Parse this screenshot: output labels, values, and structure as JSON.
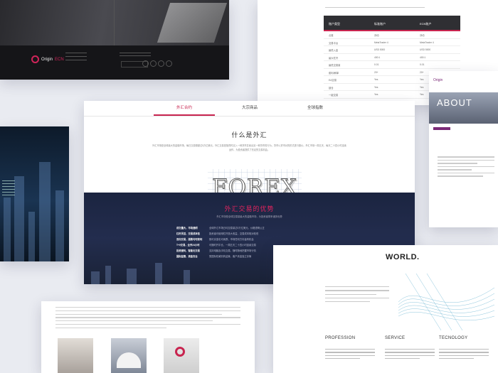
{
  "top_left_card": {
    "brand_name": "Origin",
    "brand_suffix": "ECN"
  },
  "account_table": {
    "headers": [
      "账户类型",
      "标准账户",
      "ECN账户"
    ],
    "rows": [
      [
        "点差",
        "浮动",
        "浮动"
      ],
      [
        "交易平台",
        "MetaTrader 4",
        "MetaTrader 4"
      ],
      [
        "最低入金",
        "USD 5000",
        "USD 5000"
      ],
      [
        "最大杠杆",
        "400:1",
        "400:1"
      ],
      [
        "最低交易量",
        "0.01",
        "0.01"
      ],
      [
        "套利/刷单",
        "20+",
        "20+"
      ],
      [
        "EA交易",
        "Yes",
        "Yes"
      ],
      [
        "锁仓",
        "Yes",
        "Yes"
      ],
      [
        "一键交易",
        "Yes",
        "Yes"
      ]
    ]
  },
  "about_card": {
    "brand": "Origin",
    "heading": "ABOUT"
  },
  "main": {
    "tabs": [
      {
        "label": "外汇合约",
        "active": true
      },
      {
        "label": "大宗商品",
        "active": false
      },
      {
        "label": "全球指数",
        "active": false
      }
    ],
    "title": "什么是外汇",
    "intro": "外汇市场是全球最大的金融市场，每日交易额超过5万亿美元。外汇交易是指同时买入一种货币并卖出另一种货币的行为，货币以货币对的形式进行报价。外汇市场一周五天、每天二十四小时连续运作，为投资者提供了充足的交易机会。",
    "forex_word": "FOREX",
    "advantages_title": "外汇交易的优势",
    "advantages_subtitle": "外汇市场是全球交易量最大的金融市场，为投资者带来诸多优势",
    "advantages": [
      {
        "key": "成交量大，市场透明",
        "value": "全球外汇市场日均交易量达5万亿美元，价格透明公正"
      },
      {
        "key": "杠杆灵活，交易成本低",
        "value": "投资者可使用杠杆放大收益，交易成本相对较低"
      },
      {
        "key": "双向交易，涨跌均可获利",
        "value": "既可买涨也可卖跌，市场任何方向皆有机会"
      },
      {
        "key": "T+0交易，全天24小时",
        "value": "可随时开平仓，一周五天二十四小时连续交易"
      },
      {
        "key": "投资便利，智能化交易",
        "value": "支持电脑及手机交易，随时随地把握市场行情"
      },
      {
        "key": "国际监管，资金安全",
        "value": "受国际权威机构监管，客户资金独立存管"
      }
    ]
  },
  "world_card": {
    "heading": "WORLD.",
    "columns": [
      "PROFESSION",
      "SERVICE",
      "TECNOLOGY"
    ]
  }
}
